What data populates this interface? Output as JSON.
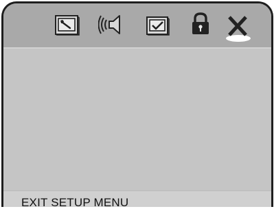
{
  "menu": {
    "icons": [
      {
        "name": "general-setup-icon",
        "selected": false
      },
      {
        "name": "audio-setup-icon",
        "selected": false
      },
      {
        "name": "preferences-icon",
        "selected": false
      },
      {
        "name": "password-lock-icon",
        "selected": false
      },
      {
        "name": "exit-icon",
        "selected": true
      }
    ]
  },
  "status": {
    "text": "EXIT SETUP MENU"
  },
  "colors": {
    "frame": "#1e1e1e",
    "topbar": "#a9a9a9",
    "content": "#c5c5c5",
    "statusbar": "#d0d0d0",
    "icon_dark": "#222222",
    "selection_highlight": "#ffffff"
  }
}
